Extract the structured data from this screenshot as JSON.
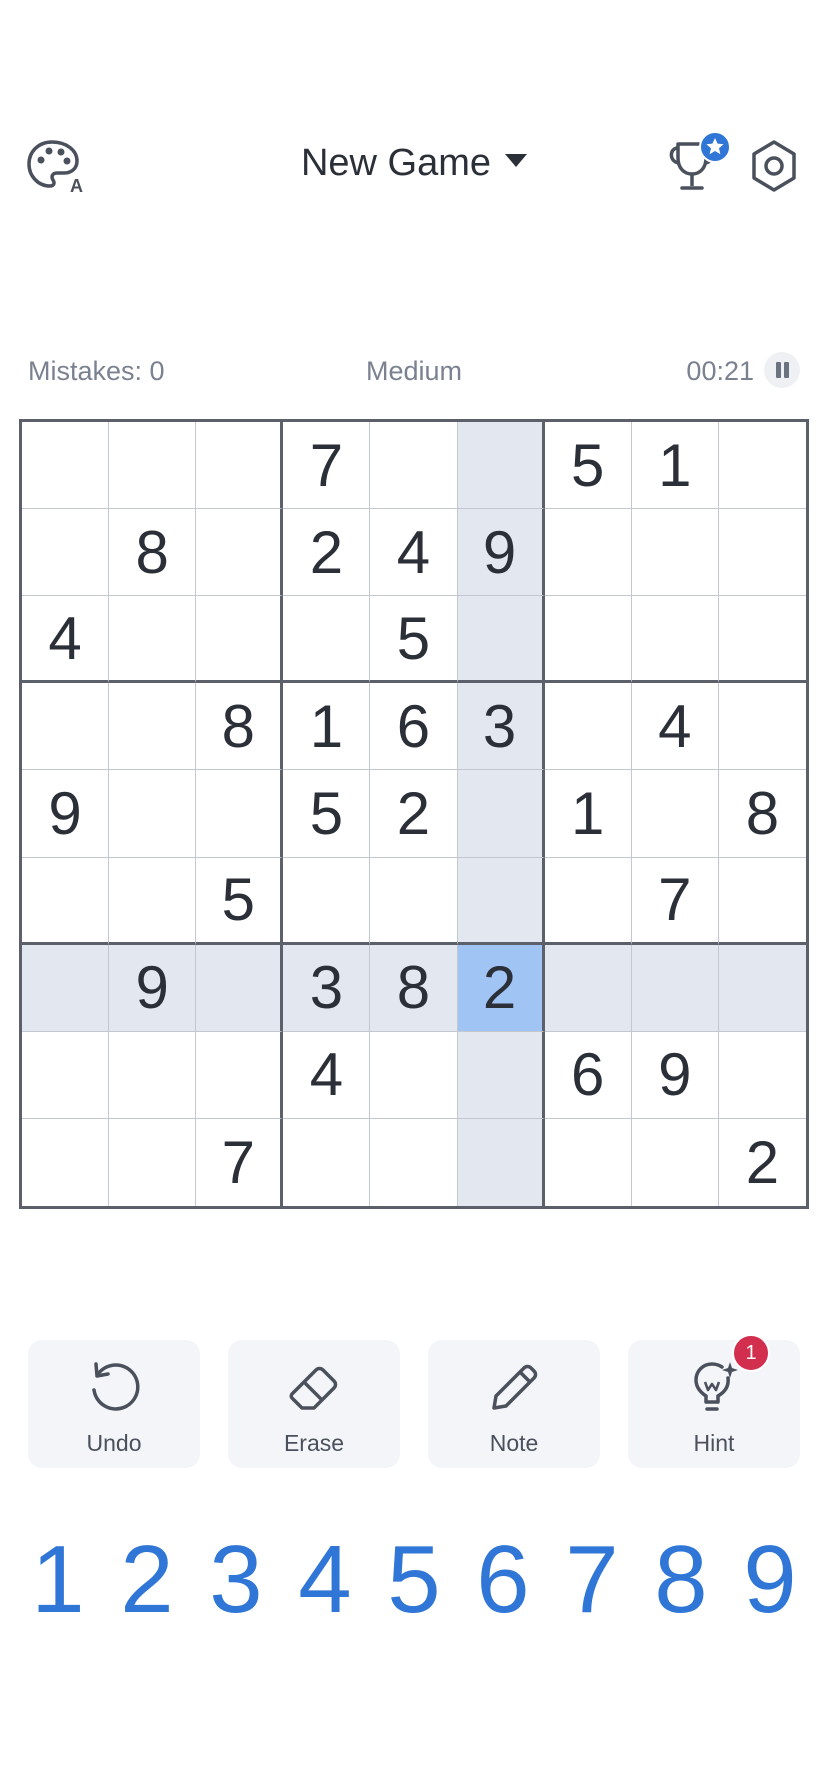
{
  "header": {
    "new_game_label": "New Game",
    "trophy_badge_icon": "star-icon",
    "accent": "#2f76d6"
  },
  "status": {
    "mistakes": "Mistakes: 0",
    "difficulty": "Medium",
    "timer": "00:21"
  },
  "board": {
    "grid": [
      [
        "",
        "",
        "",
        "7",
        "",
        "",
        "5",
        "1",
        ""
      ],
      [
        "",
        "8",
        "",
        "2",
        "4",
        "9",
        "",
        "",
        ""
      ],
      [
        "4",
        "",
        "",
        "",
        "5",
        "",
        "",
        "",
        ""
      ],
      [
        "",
        "",
        "8",
        "1",
        "6",
        "3",
        "",
        "4",
        ""
      ],
      [
        "9",
        "",
        "",
        "5",
        "2",
        "",
        "1",
        "",
        "8"
      ],
      [
        "",
        "",
        "5",
        "",
        "",
        "",
        "",
        "7",
        ""
      ],
      [
        "",
        "9",
        "",
        "3",
        "8",
        "2",
        "",
        "",
        ""
      ],
      [
        "",
        "",
        "",
        "4",
        "",
        "",
        "6",
        "9",
        ""
      ],
      [
        "",
        "",
        "7",
        "",
        "",
        "",
        "",
        "",
        "2"
      ]
    ],
    "selected_row": 6,
    "selected_col": 5,
    "highlight_color": "#e3e7ef",
    "selected_color": "#a0c4f4"
  },
  "tools": [
    {
      "label": "Undo",
      "icon": "undo-icon"
    },
    {
      "label": "Erase",
      "icon": "eraser-icon"
    },
    {
      "label": "Note",
      "icon": "pencil-icon"
    },
    {
      "label": "Hint",
      "icon": "lightbulb-icon",
      "badge": "1"
    }
  ],
  "numpad": [
    "1",
    "2",
    "3",
    "4",
    "5",
    "6",
    "7",
    "8",
    "9"
  ]
}
